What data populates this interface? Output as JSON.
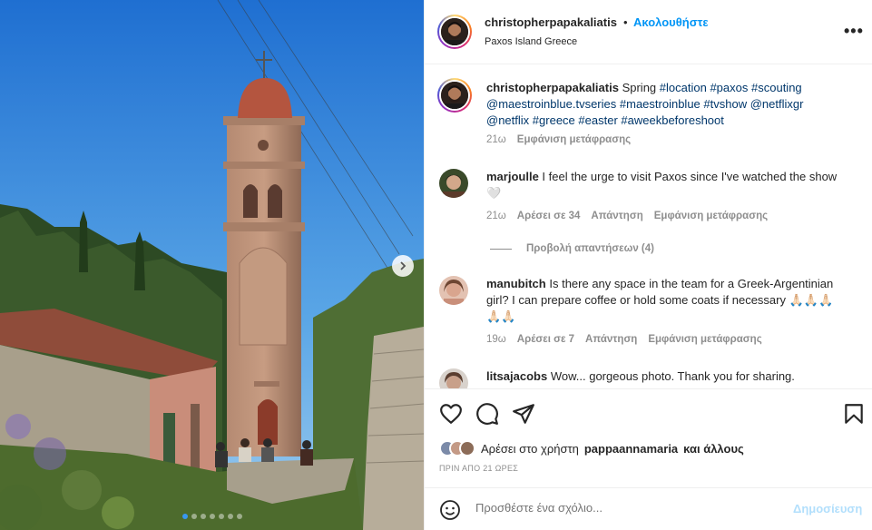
{
  "post": {
    "username": "christopherpapakaliatis",
    "separator": "•",
    "follow_label": "Ακολουθήστε",
    "location": "Paxos Island Greece",
    "more_icon": "more-horizontal-icon",
    "more_label": "•••"
  },
  "caption": {
    "username": "christopherpapakaliatis",
    "text_word": "Spring",
    "tags": [
      "#location",
      "#paxos",
      "#scouting",
      "@maestroinblue.tvseries",
      "#maestroinblue",
      "#tvshow",
      "@netflixgr",
      "@netflix",
      "#greece",
      "#easter",
      "#aweekbeforeshoot"
    ],
    "age": "21ω",
    "translate": "Εμφάνιση μετάφρασης"
  },
  "comments": [
    {
      "username": "marjoulle",
      "text": "I feel the urge to visit Paxos since I've watched the show 🤍",
      "age": "21ω",
      "likes": "Αρέσει σε 34",
      "reply": "Απάντηση",
      "translate": "Εμφάνιση μετάφρασης",
      "avatar_color": "#5b3a2a"
    },
    {
      "username": "manubitch",
      "text": "Is there any space in the team for a Greek-Argentinian girl? I can prepare coffee or hold some coats if necessary 🙏🏻🙏🏻🙏🏻🙏🏻🙏🏻",
      "age": "19ω",
      "likes": "Αρέσει σε 7",
      "reply": "Απάντηση",
      "translate": "Εμφάνιση μετάφρασης",
      "avatar_color": "#c98f7a"
    },
    {
      "username": "litsajacobs",
      "text": "Wow... gorgeous photo. Thank you for sharing.",
      "avatar_color": "#8a6a5a"
    }
  ],
  "view_replies": "Προβολή απαντήσεων (4)",
  "actions": {
    "like_icon": "heart-icon",
    "comment_icon": "comment-icon",
    "share_icon": "send-icon",
    "save_icon": "bookmark-icon"
  },
  "likes": {
    "prefix": "Αρέσει στο χρήστη",
    "user": "pappaannamaria",
    "suffix": "και άλλους"
  },
  "timestamp": "ΠΡΙΝ ΑΠΟ 21 ΩΡΕΣ",
  "add_comment": {
    "placeholder": "Προσθέστε ένα σχόλιο...",
    "post_label": "Δημοσίευση",
    "emoji_icon": "smiley-icon"
  },
  "carousel": {
    "slide_count": 7,
    "active_index": 0,
    "next_icon": "chevron-right-icon"
  },
  "colors": {
    "link_blue": "#0095f6",
    "tag_blue": "#00376b",
    "muted_gray": "#8e8e8e",
    "post_disabled": "#b2dffc"
  }
}
